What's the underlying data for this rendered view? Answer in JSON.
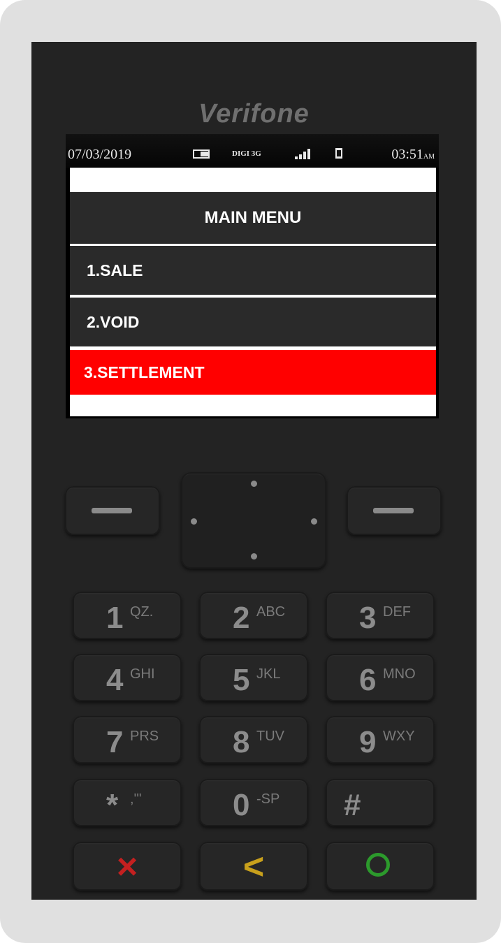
{
  "device": {
    "brand": "Verifone"
  },
  "status_bar": {
    "date": "07/03/2019",
    "network": "DIGI 3G",
    "time": "03:51",
    "meridiem": "AM"
  },
  "menu": {
    "title": "MAIN MENU",
    "items": [
      {
        "label": "1.SALE"
      },
      {
        "label": "2.VOID"
      },
      {
        "label": "3.SETTLEMENT",
        "selected": true
      }
    ],
    "highlight_color": "#ff0000"
  },
  "keypad": {
    "keys": [
      {
        "digit": "1",
        "letters": "QZ."
      },
      {
        "digit": "2",
        "letters": "ABC"
      },
      {
        "digit": "3",
        "letters": "DEF"
      },
      {
        "digit": "4",
        "letters": "GHI"
      },
      {
        "digit": "5",
        "letters": "JKL"
      },
      {
        "digit": "6",
        "letters": "MNO"
      },
      {
        "digit": "7",
        "letters": "PRS"
      },
      {
        "digit": "8",
        "letters": "TUV"
      },
      {
        "digit": "9",
        "letters": "WXY"
      },
      {
        "digit": "*",
        "letters": ",'\""
      },
      {
        "digit": "0",
        "letters": "-SP"
      },
      {
        "digit": "#",
        "letters": ""
      }
    ],
    "cancel_icon": "×",
    "back_icon": "<",
    "enter_icon": "circle-icon",
    "colors": {
      "cancel": "#c42020",
      "back": "#c8a01c",
      "enter": "#2c9a2c"
    }
  }
}
